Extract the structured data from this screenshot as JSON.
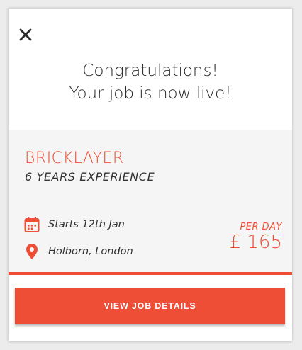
{
  "header": {
    "close_icon": "close-icon",
    "title_line1": "Congratulations!",
    "title_line2": "Your job is now live!"
  },
  "job": {
    "title": "BRICKLAYER",
    "experience": "6 YEARS EXPERIENCE",
    "start_date": "Starts 12th Jan",
    "location": "Holborn, London",
    "rate_label": "PER DAY",
    "rate_value": "£ 165",
    "calendar_icon": "calendar-icon",
    "location_icon": "location-pin-icon"
  },
  "actions": {
    "view_details_label": "VIEW JOB DETAILS"
  },
  "colors": {
    "accent": "#ef4e36",
    "panel_bg": "#f5f5f5",
    "text": "#2f2f2f"
  }
}
